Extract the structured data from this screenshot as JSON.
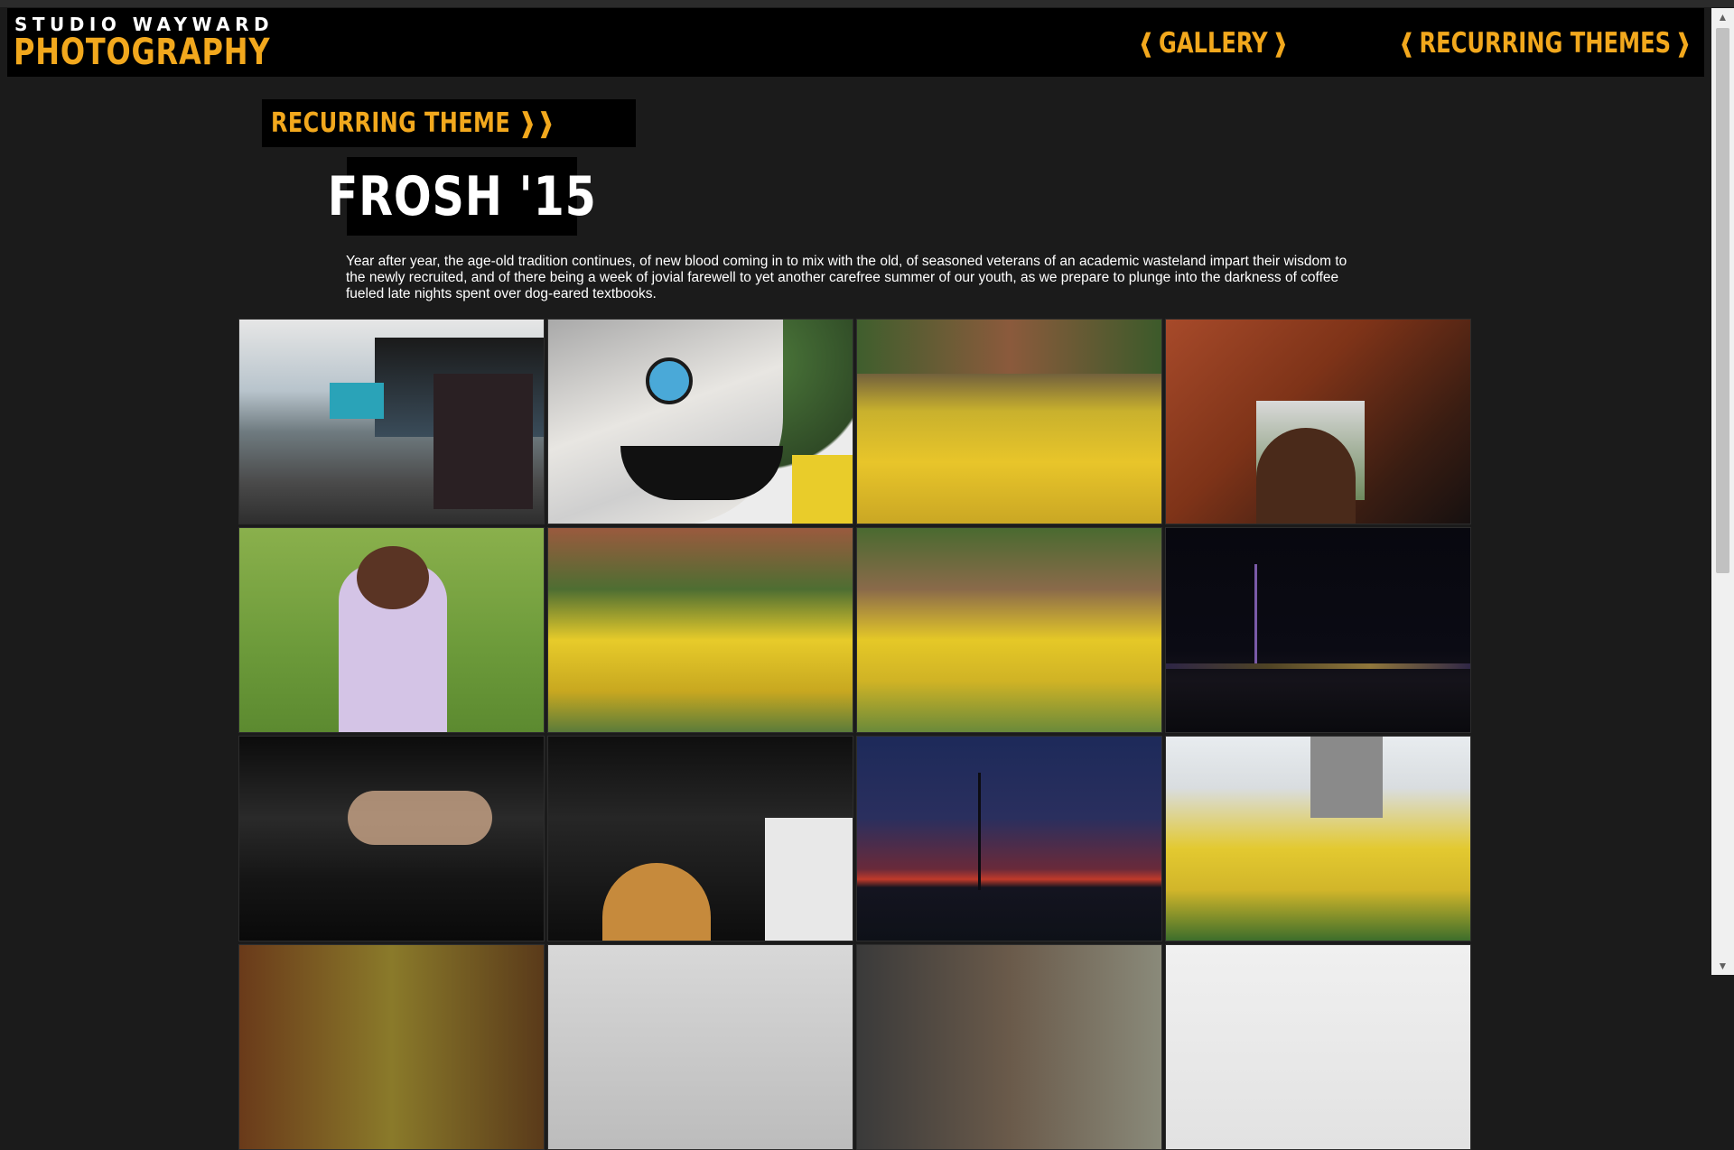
{
  "brand": {
    "top": "STUDIO WAYWARD",
    "main": "PHOTOGRAPHY"
  },
  "nav": {
    "gallery": "GALLERY",
    "recurring_themes": "RECURRING THEMES",
    "open_bracket": "❰",
    "close_bracket": "❱"
  },
  "page": {
    "tag": "RECURRING THEME ❱❱",
    "title": "FROSH '15",
    "description": "Year after year, the age-old tradition continues, of new blood coming in to mix with the old, of seasoned veterans of an academic wasteland impart their wisdom to the newly recruited, and of there being a week of jovial farewell to yet another carefree summer of our youth, as we prepare to plunge into the darkness of coffee fueled late nights spent over dog-eared textbooks."
  },
  "colors": {
    "accent": "#f2a81d",
    "background": "#1b1b1b",
    "header": "#000000"
  }
}
